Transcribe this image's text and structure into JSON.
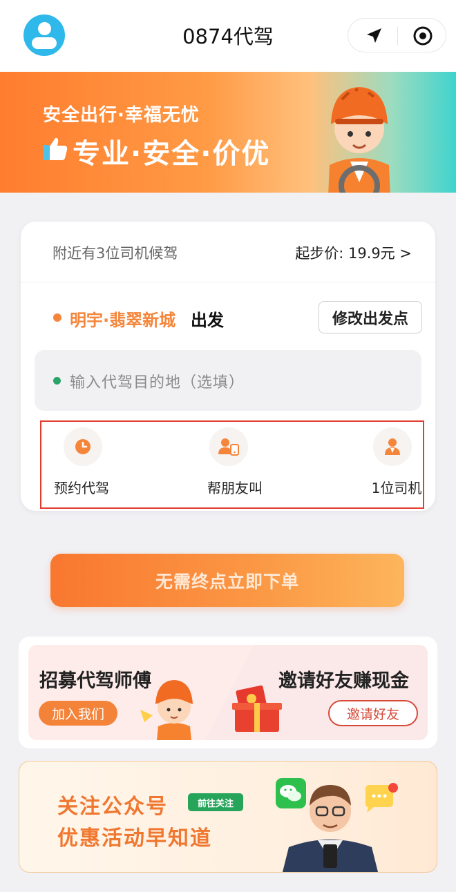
{
  "header": {
    "title": "0874代驾"
  },
  "banner": {
    "line1": "安全出行·幸福无忧",
    "line2": "专业·安全·价优"
  },
  "card": {
    "nearby_text": "附近有3位司机候驾",
    "start_price": "起步价: 19.9元 >",
    "origin_name": "明宇·翡翠新城",
    "origin_suffix": "出发",
    "change_origin_label": "修改出发点",
    "destination_placeholder": "输入代驾目的地（选填）",
    "options": [
      {
        "label": "预约代驾",
        "icon": "clock-icon"
      },
      {
        "label": "帮朋友叫",
        "icon": "friend-call-icon"
      },
      {
        "label": "1位司机",
        "icon": "driver-icon"
      }
    ]
  },
  "order_button_label": "无需终点立即下单",
  "promo": {
    "recruit_title": "招募代驾师傅",
    "join_label": "加入我们",
    "invite_title": "邀请好友赚现金",
    "invite_label": "邀请好友"
  },
  "follow": {
    "line1": "关注公众号",
    "tag": "前往关注",
    "line2": "优惠活动早知道"
  },
  "colors": {
    "accent": "#f5853a",
    "header_avatar": "#2fb9ea",
    "wechat_green": "#26a45a",
    "highlight_border": "#e33b2f"
  }
}
